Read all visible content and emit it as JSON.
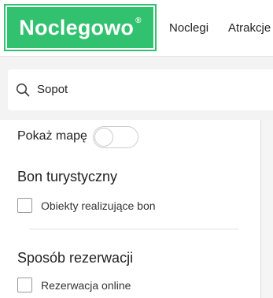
{
  "header": {
    "logo_text": "Noclegowo",
    "logo_mark": "®",
    "nav": [
      {
        "label": "Noclegi"
      },
      {
        "label": "Atrakcje"
      }
    ]
  },
  "search": {
    "value": "Sopot",
    "icon": "search-icon"
  },
  "filters": {
    "map_toggle": {
      "label": "Pokaż mapę",
      "checked": false
    },
    "sections": [
      {
        "title": "Bon turystyczny",
        "options": [
          {
            "label": "Obiekty realizujące bon",
            "checked": false
          }
        ]
      },
      {
        "title": "Sposób rezerwacji",
        "options": [
          {
            "label": "Rezerwacja online",
            "checked": false
          }
        ]
      }
    ]
  },
  "colors": {
    "brand": "#32c16f",
    "search_band": "#f3f3f3"
  }
}
